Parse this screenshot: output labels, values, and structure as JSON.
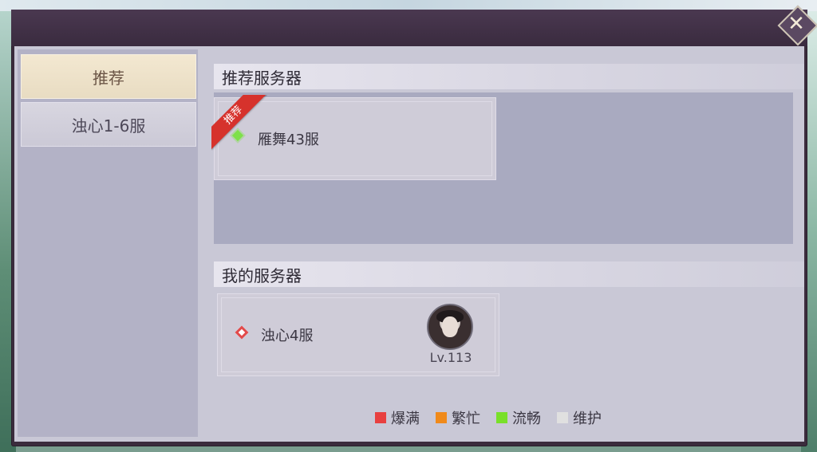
{
  "sidebar": {
    "items": [
      {
        "label": "推荐",
        "active": true
      },
      {
        "label": "浊心1-6服",
        "active": false
      }
    ]
  },
  "recommended": {
    "title": "推荐服务器",
    "server": {
      "name": "雁舞43服",
      "ribbon": "推荐",
      "status_color": "#7ee04a"
    }
  },
  "mine": {
    "title": "我的服务器",
    "server": {
      "name": "浊心4服",
      "level": "Lv.113",
      "status_color": "#e24a4a"
    }
  },
  "legend": [
    {
      "label": "爆满",
      "color": "#e84040"
    },
    {
      "label": "繁忙",
      "color": "#f08a1a"
    },
    {
      "label": "流畅",
      "color": "#79e02a"
    },
    {
      "label": "维护",
      "color": "#e0e0e0"
    }
  ],
  "icons": {
    "close": "close-icon"
  }
}
